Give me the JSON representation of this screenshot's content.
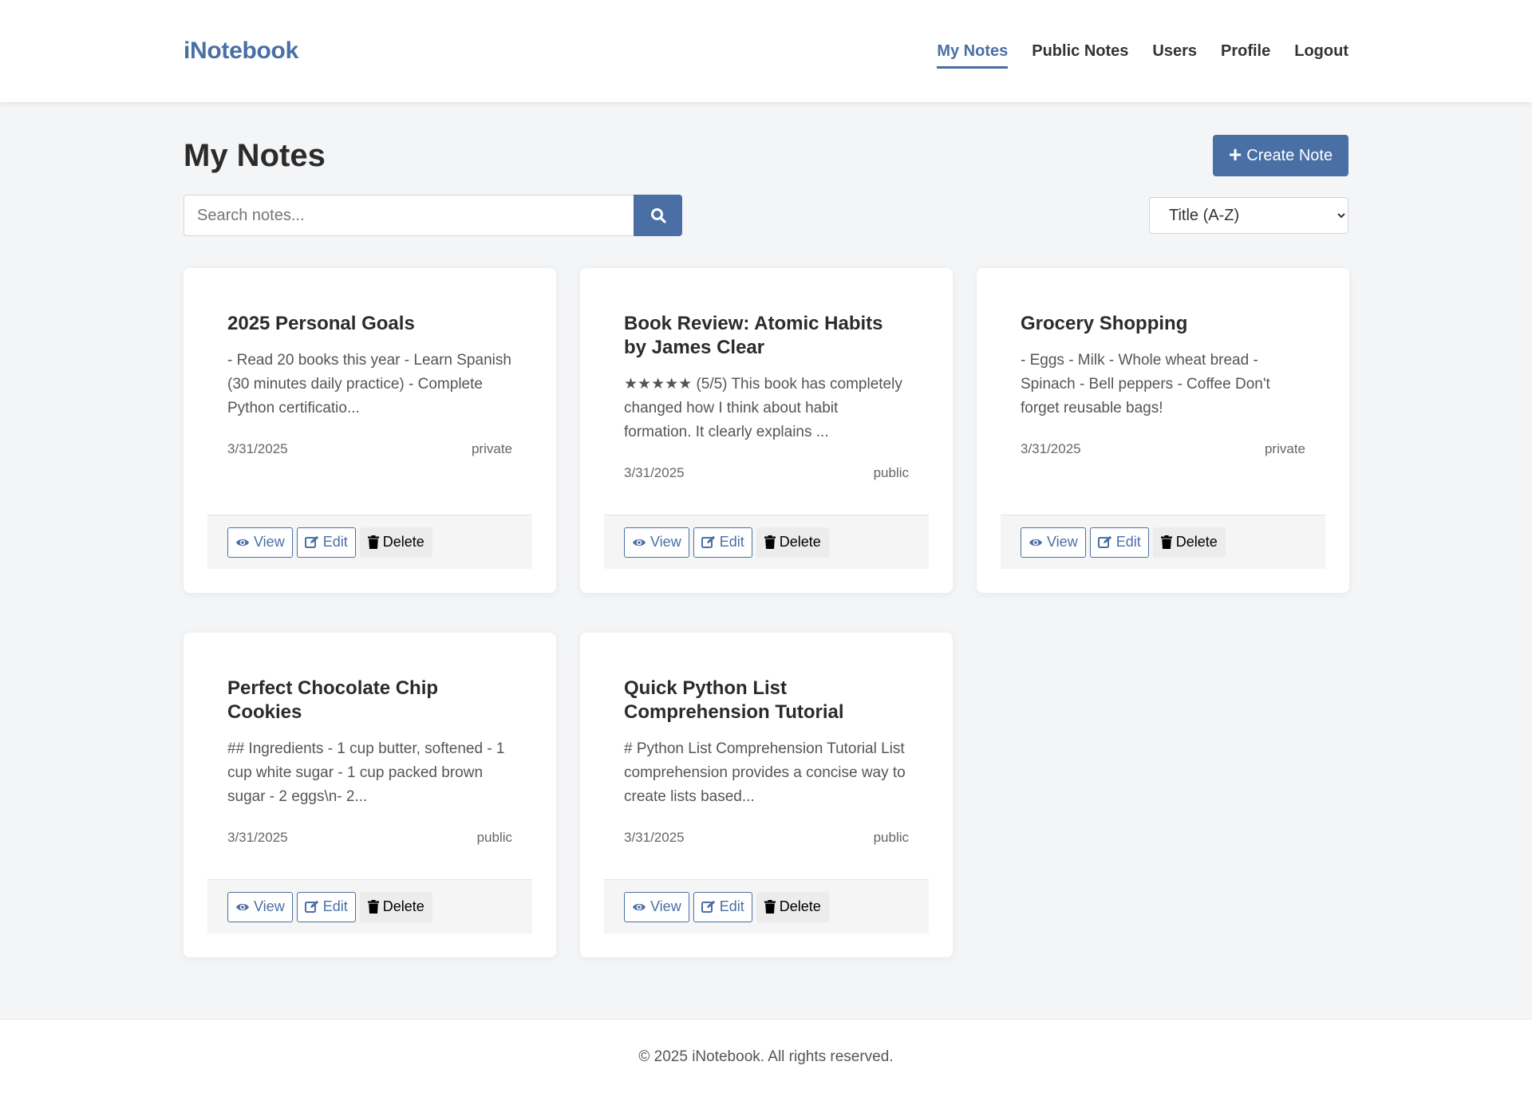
{
  "header": {
    "brand": "iNotebook",
    "nav": [
      {
        "label": "My Notes",
        "active": true
      },
      {
        "label": "Public Notes",
        "active": false
      },
      {
        "label": "Users",
        "active": false
      },
      {
        "label": "Profile",
        "active": false
      },
      {
        "label": "Logout",
        "active": false
      }
    ]
  },
  "main": {
    "title": "My Notes",
    "create_label": "Create Note",
    "search": {
      "placeholder": "Search notes...",
      "value": ""
    },
    "sort": {
      "selected": "Title (A-Z)"
    },
    "actions": {
      "view": "View",
      "edit": "Edit",
      "delete": "Delete"
    },
    "notes": [
      {
        "title": "2025 Personal Goals",
        "excerpt": "- Read 20 books this year - Learn Spanish (30 minutes daily practice) - Complete Python certificatio...",
        "date": "3/31/2025",
        "visibility": "private"
      },
      {
        "title": "Book Review: Atomic Habits by James Clear",
        "excerpt": "★★★★★ (5/5) This book has completely changed how I think about habit formation. It clearly explains ...",
        "date": "3/31/2025",
        "visibility": "public"
      },
      {
        "title": "Grocery Shopping",
        "excerpt": "- Eggs - Milk - Whole wheat bread - Spinach - Bell peppers - Coffee Don't forget reusable bags!",
        "date": "3/31/2025",
        "visibility": "private"
      },
      {
        "title": "Perfect Chocolate Chip Cookies",
        "excerpt": "## Ingredients - 1 cup butter, softened - 1 cup white sugar - 1 cup packed brown sugar - 2 eggs\\n- 2...",
        "date": "3/31/2025",
        "visibility": "public"
      },
      {
        "title": "Quick Python List Comprehension Tutorial",
        "excerpt": "# Python List Comprehension Tutorial List comprehension provides a concise way to create lists based...",
        "date": "3/31/2025",
        "visibility": "public"
      }
    ]
  },
  "footer": {
    "text": "© 2025 iNotebook. All rights reserved."
  },
  "colors": {
    "accent": "#4a6fa5",
    "background": "#f4f5f7"
  }
}
